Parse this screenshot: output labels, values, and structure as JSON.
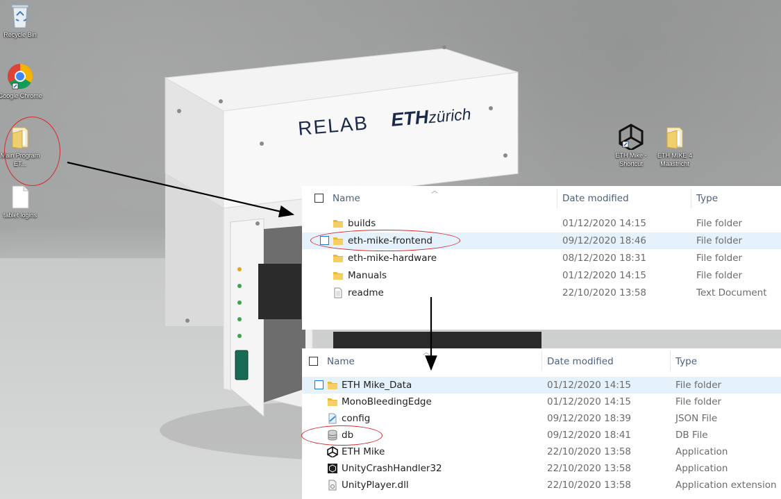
{
  "desktop": {
    "icons": [
      {
        "label": "Recycle Bin",
        "icon": "recycle-bin-icon"
      },
      {
        "label": "Google Chrome",
        "icon": "chrome-icon"
      },
      {
        "label": "Main Program ET...",
        "icon": "folder-icon"
      },
      {
        "label": "tablet logins",
        "icon": "text-file-icon"
      },
      {
        "label": "ETH Mike - Shortcut",
        "icon": "unity-icon"
      },
      {
        "label": "ETH MIKE 4 Maastricht",
        "icon": "folder-icon"
      }
    ],
    "wallpaper": {
      "logo_left": "RELAB",
      "logo_right_bold": "ETH",
      "logo_right_italic": "zürich"
    }
  },
  "explorer_top": {
    "columns": {
      "name": "Name",
      "date": "Date modified",
      "type": "Type"
    },
    "rows": [
      {
        "name": "builds",
        "date": "01/12/2020 14:15",
        "type": "File folder",
        "icon": "folder-icon"
      },
      {
        "name": "eth-mike-frontend",
        "date": "09/12/2020 18:46",
        "type": "File folder",
        "icon": "folder-icon"
      },
      {
        "name": "eth-mike-hardware",
        "date": "08/12/2020 18:31",
        "type": "File folder",
        "icon": "folder-icon"
      },
      {
        "name": "Manuals",
        "date": "01/12/2020 14:15",
        "type": "File folder",
        "icon": "folder-icon"
      },
      {
        "name": "readme",
        "date": "22/10/2020 13:58",
        "type": "Text Document",
        "icon": "text-document-icon"
      }
    ]
  },
  "explorer_bottom": {
    "columns": {
      "name": "Name",
      "date": "Date modified",
      "type": "Type"
    },
    "rows": [
      {
        "name": "ETH Mike_Data",
        "date": "01/12/2020 14:15",
        "type": "File folder",
        "icon": "folder-icon"
      },
      {
        "name": "MonoBleedingEdge",
        "date": "01/12/2020 14:15",
        "type": "File folder",
        "icon": "folder-icon"
      },
      {
        "name": "config",
        "date": "09/12/2020 18:39",
        "type": "JSON File",
        "icon": "json-file-icon"
      },
      {
        "name": "db",
        "date": "09/12/2020 18:41",
        "type": "DB File",
        "icon": "database-icon"
      },
      {
        "name": "ETH Mike",
        "date": "22/10/2020 13:58",
        "type": "Application",
        "icon": "unity-icon"
      },
      {
        "name": "UnityCrashHandler32",
        "date": "22/10/2020 13:58",
        "type": "Application",
        "icon": "unity-crash-handler-icon"
      },
      {
        "name": "UnityPlayer.dll",
        "date": "22/10/2020 13:58",
        "type": "Application extension",
        "icon": "dll-icon"
      }
    ]
  },
  "colors": {
    "annotation": "#d9262c",
    "selection": "#e5f1fb",
    "header_text": "#4c607a",
    "folder": "#e8b73e"
  }
}
